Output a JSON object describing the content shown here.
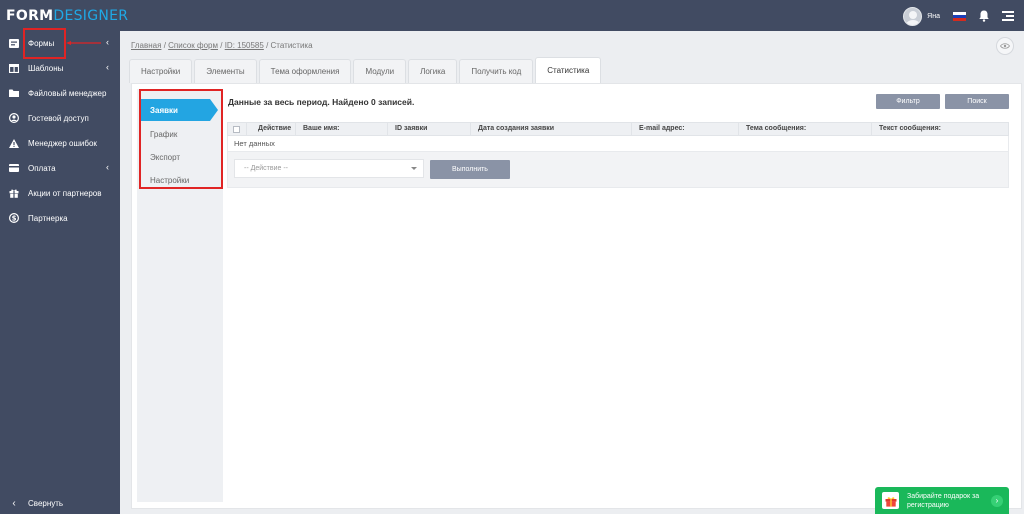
{
  "app": {
    "logo_part1": "FORM",
    "logo_part2": "DESIGNER"
  },
  "topbar": {
    "user_name": "Яна"
  },
  "sidebar": {
    "items": [
      {
        "label": "Формы",
        "icon": "forms-icon",
        "has_chevron": true
      },
      {
        "label": "Шаблоны",
        "icon": "templates-icon",
        "has_chevron": true
      },
      {
        "label": "Файловый менеджер",
        "icon": "folder-icon",
        "has_chevron": false
      },
      {
        "label": "Гостевой доступ",
        "icon": "user-circle-icon",
        "has_chevron": false
      },
      {
        "label": "Менеджер ошибок",
        "icon": "warning-icon",
        "has_chevron": false
      },
      {
        "label": "Оплата",
        "icon": "card-icon",
        "has_chevron": true
      },
      {
        "label": "Акции от партнеров",
        "icon": "gift-icon",
        "has_chevron": false
      },
      {
        "label": "Партнерка",
        "icon": "dollar-icon",
        "has_chevron": false
      }
    ],
    "collapse_label": "Свернуть",
    "chevron": "‹",
    "collapse_chevron": "‹"
  },
  "breadcrumb": {
    "home": "Главная",
    "sep": "/",
    "forms_list": "Список форм",
    "form_id": "ID: 150585",
    "current": "Статистика"
  },
  "tabs": [
    "Настройки",
    "Элементы",
    "Тема оформления",
    "Модули",
    "Логика",
    "Получить код",
    "Статистика"
  ],
  "active_tab": "Статистика",
  "left_menu": {
    "items": [
      "Заявки",
      "График",
      "Экспорт",
      "Настройки"
    ],
    "active": "Заявки"
  },
  "panel": {
    "title": "Данные за весь период. Найдено 0 записей.",
    "filter_button": "Фильтр",
    "search_button": "Поиск"
  },
  "table": {
    "columns": [
      "Действие",
      "Ваше имя:",
      "ID заявки",
      "Дата создания заявки",
      "E-mail адрес:",
      "Тема сообщения:",
      "Текст сообщения:"
    ],
    "empty_text": "Нет данных"
  },
  "bulk_action": {
    "placeholder": "-- Действие --",
    "execute_button": "Выполнить"
  },
  "promo": {
    "text": "Забирайте подарок за регистрацию",
    "arrow": "›"
  },
  "colors": {
    "sidebar_bg": "#414b62",
    "accent_blue": "#23a5e2",
    "highlight_red": "#e02424",
    "button_gray": "#8a93a6",
    "promo_green": "#1ab85a"
  }
}
